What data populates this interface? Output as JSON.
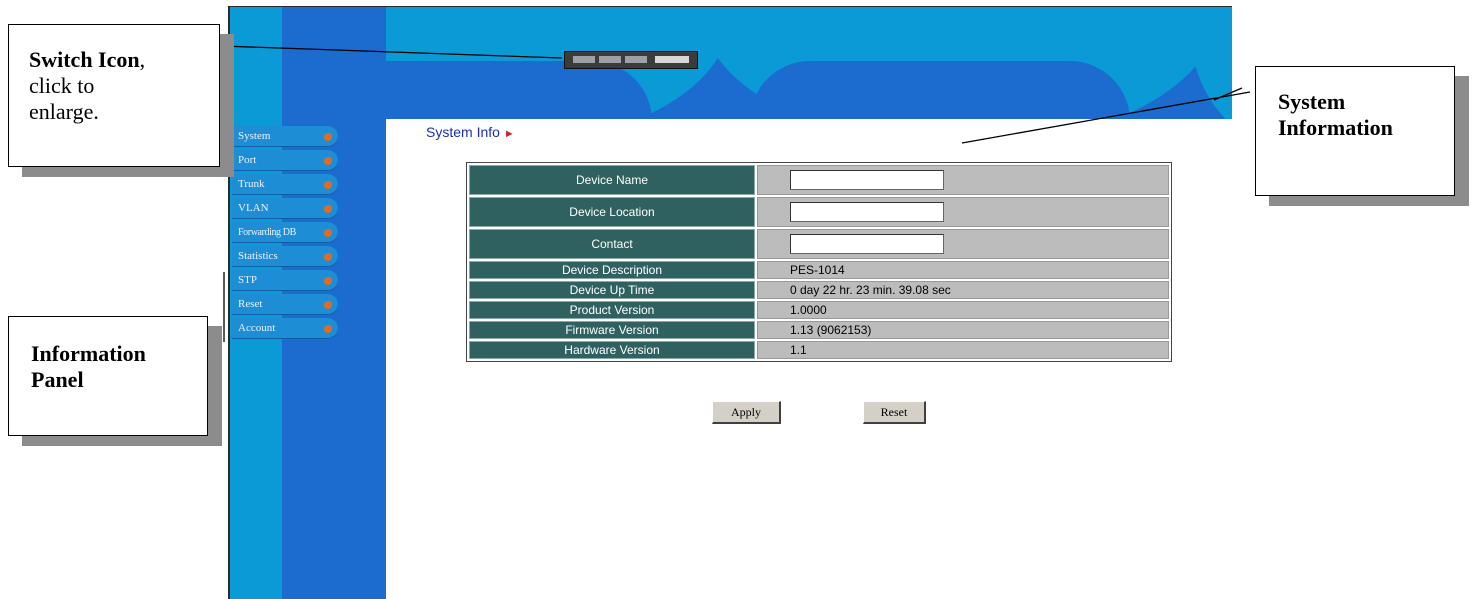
{
  "header": {
    "switch_icon": "switch-icon"
  },
  "sidebar": {
    "items": [
      {
        "label": "System"
      },
      {
        "label": "Port"
      },
      {
        "label": "Trunk"
      },
      {
        "label": "VLAN"
      },
      {
        "label": "Forwarding DB"
      },
      {
        "label": "Statistics"
      },
      {
        "label": "STP"
      },
      {
        "label": "Reset"
      },
      {
        "label": "Account"
      }
    ]
  },
  "main": {
    "title": "System Info",
    "fields": [
      {
        "label": "Device Name",
        "value": ""
      },
      {
        "label": "Device Location",
        "value": ""
      },
      {
        "label": "Contact",
        "value": ""
      },
      {
        "label": "Device Description",
        "value": "PES-1014"
      },
      {
        "label": "Device Up Time",
        "value": "0 day 22 hr. 23 min. 39.08 sec"
      },
      {
        "label": "Product Version",
        "value": "1.0000"
      },
      {
        "label": "Firmware Version",
        "value": "1.13 (9062153)"
      },
      {
        "label": "Hardware Version",
        "value": "1.1"
      }
    ],
    "apply_label": "Apply",
    "reset_label": "Reset"
  },
  "callouts": {
    "switch_title": "Switch Icon",
    "switch_rest_1": ",",
    "switch_line2": "click to",
    "switch_line3": "enlarge.",
    "sysinfo_line1": "System",
    "sysinfo_line2": "Information",
    "info_line1": "Information",
    "info_line2": "Panel"
  },
  "colors": {
    "banner_blue": "#1c6cd0",
    "banner_light": "#0a9bd6",
    "label_cell": "#2f6161",
    "value_cell": "#bcbcbc",
    "title_text": "#1b2fb6",
    "arrow": "#d02030",
    "menu_dot": "#e06a2a"
  }
}
